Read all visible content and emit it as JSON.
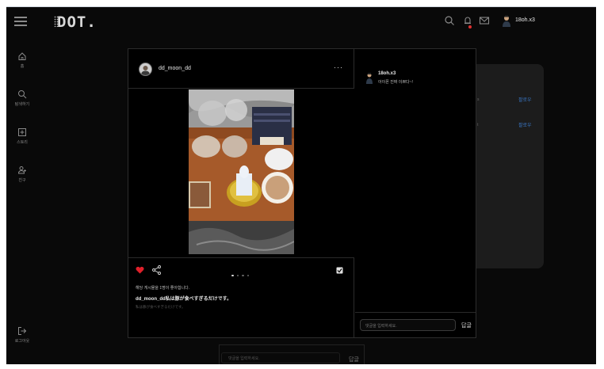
{
  "header": {
    "logo": "DOT.",
    "username": "18oh.x3"
  },
  "sidebar": {
    "items": [
      {
        "label": "홈"
      },
      {
        "label": "탐색하기"
      },
      {
        "label": "스토리"
      },
      {
        "label": "친구"
      },
      {
        "label": "로그아웃"
      }
    ]
  },
  "background": {
    "follow_labels": [
      "팔로우",
      "팔로우"
    ],
    "bottom_input_placeholder": "댓글을 입력하세요.",
    "bottom_submit": "답글"
  },
  "post": {
    "author": "dd_moon_dd",
    "more_label": "···",
    "likes_text": "해당 게시물을 1명이 좋아합니다.",
    "caption": "dd_moon_dd私は豚が食べすぎるだけです。",
    "caption_sub": "私は豚が食べすぎるだけです。",
    "photo_count": 4,
    "active_photo": 1,
    "liked": true,
    "saved": true,
    "accent_color": "#e0202a"
  },
  "comments": {
    "items": [
      {
        "user": "18oh.x3",
        "text": "아이폰 진짜 이쁘다~!"
      }
    ],
    "input_placeholder": "댓글을 입력하세요.",
    "submit_label": "답글"
  }
}
